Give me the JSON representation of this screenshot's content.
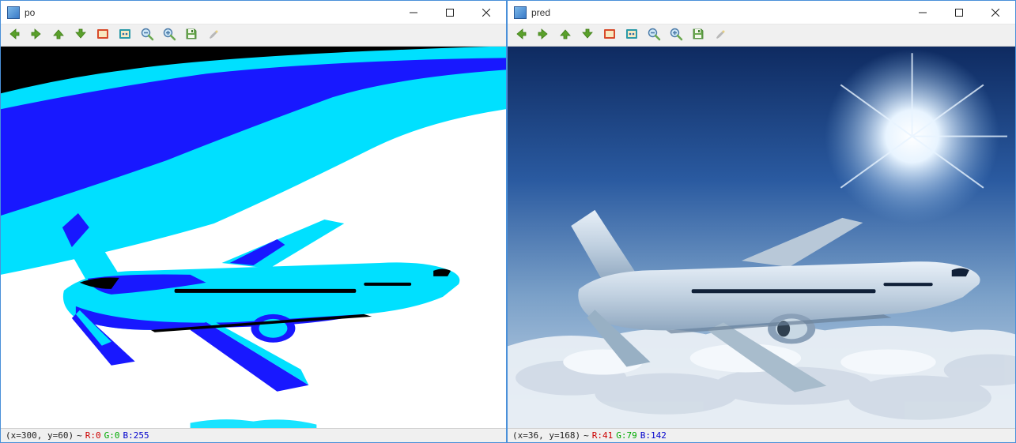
{
  "windows": [
    {
      "id": "left",
      "title": "po",
      "status": {
        "coord": "(x=300, y=60)",
        "tilde": "~",
        "r": "R:0",
        "g": "G:0",
        "b": "B:255"
      }
    },
    {
      "id": "right",
      "title": "pred",
      "status": {
        "coord": "(x=36, y=168)",
        "tilde": "~",
        "r": "R:41",
        "g": "G:79",
        "b": "B:142"
      }
    }
  ],
  "toolbar_icons": [
    "back-icon",
    "forward-icon",
    "up-icon",
    "down-icon",
    "frame-icon",
    "meta-icon",
    "zoom-out-icon",
    "zoom-in-icon",
    "save-icon",
    "brush-icon"
  ],
  "colors": {
    "arrow_green": "#5aa02c",
    "arrow_green_dark": "#3b7a12",
    "save_green": "#6aa850",
    "save_dark": "#3d7a2a",
    "frame_red": "#d84a2a",
    "frame_teal": "#2a9aa8",
    "frame_inner": "#f8e8c0",
    "zoom_lens": "#cfe8f8",
    "zoom_ring": "#4a7aa8",
    "zoom_handle": "#6aa850",
    "brush_gray": "#b8b8b8",
    "posterize_black": "#000000",
    "posterize_blue": "#1818ff",
    "posterize_cyan": "#00e0ff",
    "posterize_white": "#ffffff",
    "sky_top": "#1a3a78",
    "sky_mid": "#5a88c0",
    "sky_low": "#a8c0d8",
    "cloud": "#e8eef4",
    "plane_body": "#c8d8e4",
    "plane_shadow": "#8098b0"
  }
}
